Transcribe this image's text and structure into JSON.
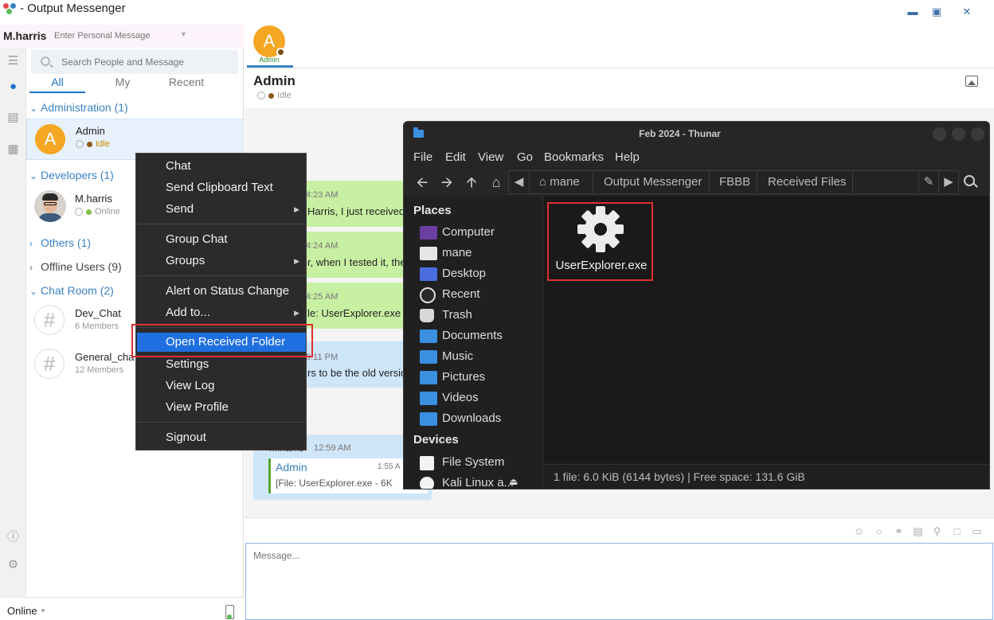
{
  "app": {
    "title": "- Output Messenger",
    "user_name": "M.harris",
    "personal_message_placeholder": "Enter Personal Message",
    "search_placeholder": "Search People and Message",
    "tabs": [
      "All",
      "My",
      "Recent"
    ],
    "status": "Online"
  },
  "groups": {
    "administration": "Administration (1)",
    "developers": "Developers (1)",
    "others": "Others (1)",
    "offline": "Offline Users (9)",
    "chatroom": "Chat Room (2)"
  },
  "contacts": {
    "admin": {
      "initial": "A",
      "name": "Admin",
      "status": "Idle"
    },
    "mharris": {
      "name": "M.harris",
      "status": "Online"
    },
    "dev_chat": {
      "name": "Dev_Chat",
      "members": "6 Members"
    },
    "general_chat": {
      "name": "General_cha",
      "members": "12 Members"
    }
  },
  "chat": {
    "top_avatar_initial": "A",
    "top_avatar_label": "Admin",
    "name": "Admin",
    "status": "Idle",
    "message_placeholder": "Message...",
    "messages": [
      {
        "time": "4:23 AM",
        "text": "Harris, I just received"
      },
      {
        "time": "4:24 AM",
        "text": "r, when I tested it, the"
      },
      {
        "time": "4:25 AM",
        "text": "le: UserExplorer.exe"
      },
      {
        "time": "9:11 PM",
        "text": "rs to be the old versio"
      }
    ],
    "last": {
      "sender": "M.harris",
      "time": "12:59 AM",
      "file_sender": "Admin",
      "file_time": "1:55 A",
      "file_text": "[File: UserExplorer.exe - 6K"
    }
  },
  "context_menu": {
    "items": [
      "Chat",
      "Send Clipboard Text",
      "Send",
      "Group Chat",
      "Groups",
      "Alert on Status Change",
      "Add to...",
      "Open Received Folder",
      "Settings",
      "View Log",
      "View Profile",
      "Signout"
    ]
  },
  "thunar": {
    "title": "Feb 2024 - Thunar",
    "menu": [
      "File",
      "Edit",
      "View",
      "Go",
      "Bookmarks",
      "Help"
    ],
    "path": [
      "mane",
      "Output Messenger",
      "FBBB",
      "Received Files"
    ],
    "places_header": "Places",
    "places": [
      "Computer",
      "mane",
      "Desktop",
      "Recent",
      "Trash",
      "Documents",
      "Music",
      "Pictures",
      "Videos",
      "Downloads"
    ],
    "devices_header": "Devices",
    "devices": [
      "File System",
      "Kali Linux a..."
    ],
    "file_name": "UserExplorer.exe",
    "status": "1 file: 6.0 KiB (6144 bytes)  |  Free space: 131.6 GiB"
  },
  "colors": {
    "accent": "#1a73c9",
    "highlight": "#1f6fe0",
    "bubble_green": "#c8f0a2",
    "bubble_blue": "#cfe5f8",
    "avatar_orange": "#f5a623"
  }
}
